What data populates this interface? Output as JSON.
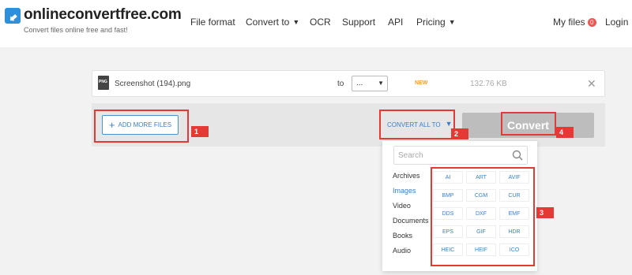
{
  "header": {
    "logo_text": "onlineconvertfree.com",
    "tagline": "Convert files online free and fast!",
    "nav": {
      "file_format": "File format",
      "convert_to": "Convert to",
      "ocr": "OCR",
      "support": "Support",
      "api": "API",
      "pricing": "Pricing",
      "my_files": "My files",
      "my_files_count": "0",
      "login": "Login"
    }
  },
  "file": {
    "name": "Screenshot (194).png",
    "icon_label": "PNG",
    "to_label": "to",
    "target_value": "...",
    "status": "NEW",
    "size": "132.76 KB"
  },
  "actions": {
    "add_files": "ADD MORE FILES",
    "convert_all": "CONVERT ALL TO",
    "convert": "Convert"
  },
  "dropdown": {
    "search_placeholder": "Search",
    "categories": [
      "Archives",
      "Images",
      "Video",
      "Documents",
      "Books",
      "Audio"
    ],
    "active_category": "Images",
    "formats": [
      "AI",
      "ART",
      "AVIF",
      "BMP",
      "CGM",
      "CUR",
      "DDS",
      "DXF",
      "EMF",
      "EPS",
      "GIF",
      "HDR",
      "HEIC",
      "HEIF",
      "ICO"
    ]
  },
  "annotations": [
    "1",
    "2",
    "3",
    "4"
  ],
  "colors": {
    "accent": "#3a7fc8",
    "highlight": "#e53935",
    "convert_button": "#bdbdbd"
  }
}
